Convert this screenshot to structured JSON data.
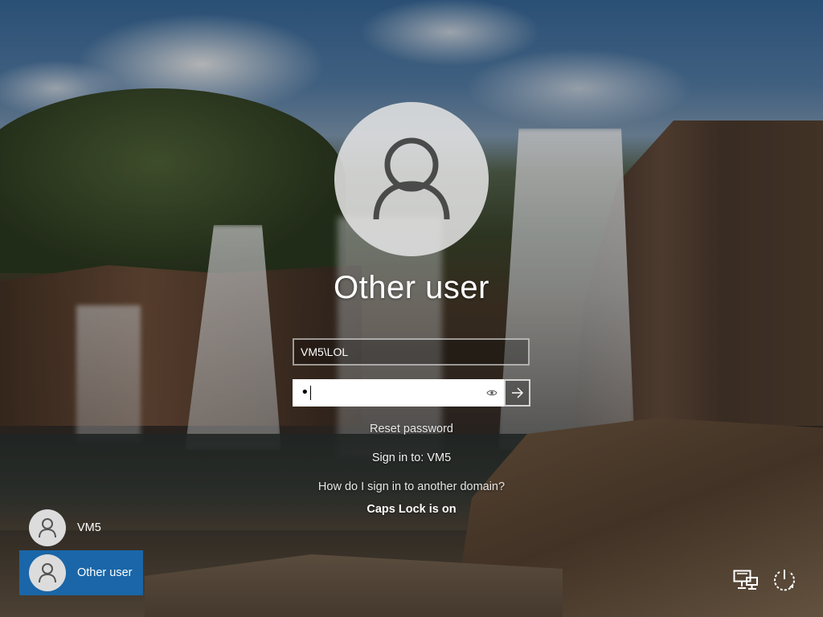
{
  "login": {
    "title": "Other user",
    "username_value": "VM5\\LOL",
    "password_masked": "•",
    "reset_password": "Reset password",
    "sign_in_to": "Sign in to: VM5",
    "domain_help": "How do I sign in to another domain?",
    "caps_lock_notice": "Caps Lock is on"
  },
  "user_list": [
    {
      "name": "VM5",
      "selected": false
    },
    {
      "name": "Other user",
      "selected": true
    }
  ],
  "icons": {
    "avatar": "user-silhouette-icon",
    "reveal_password": "eye-icon",
    "submit": "arrow-right-icon",
    "network": "network-icon",
    "power": "power-icon"
  },
  "colors": {
    "selected_tile": "#1a66a8",
    "avatar_bg": "#e1e1e1"
  }
}
